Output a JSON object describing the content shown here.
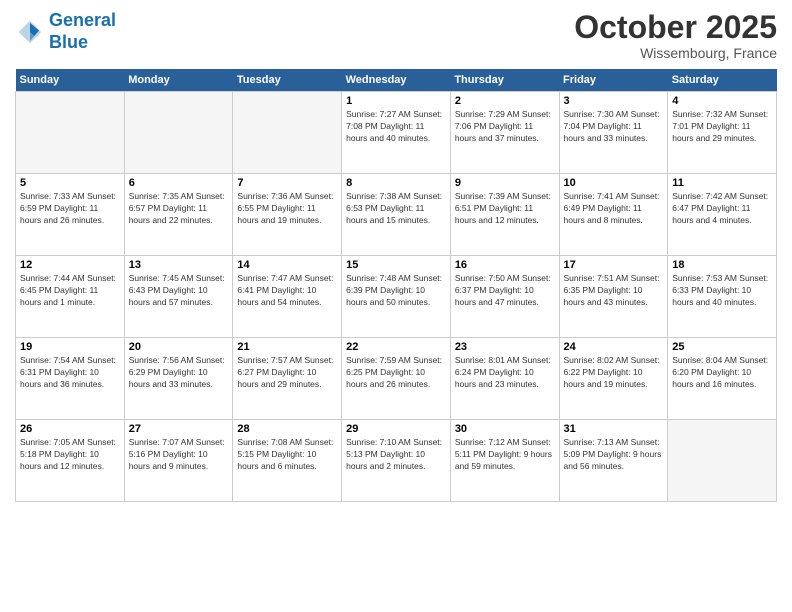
{
  "logo": {
    "line1": "General",
    "line2": "Blue"
  },
  "title": "October 2025",
  "location": "Wissembourg, France",
  "days_of_week": [
    "Sunday",
    "Monday",
    "Tuesday",
    "Wednesday",
    "Thursday",
    "Friday",
    "Saturday"
  ],
  "weeks": [
    [
      {
        "day": "",
        "info": ""
      },
      {
        "day": "",
        "info": ""
      },
      {
        "day": "",
        "info": ""
      },
      {
        "day": "1",
        "info": "Sunrise: 7:27 AM\nSunset: 7:08 PM\nDaylight: 11 hours\nand 40 minutes."
      },
      {
        "day": "2",
        "info": "Sunrise: 7:29 AM\nSunset: 7:06 PM\nDaylight: 11 hours\nand 37 minutes."
      },
      {
        "day": "3",
        "info": "Sunrise: 7:30 AM\nSunset: 7:04 PM\nDaylight: 11 hours\nand 33 minutes."
      },
      {
        "day": "4",
        "info": "Sunrise: 7:32 AM\nSunset: 7:01 PM\nDaylight: 11 hours\nand 29 minutes."
      }
    ],
    [
      {
        "day": "5",
        "info": "Sunrise: 7:33 AM\nSunset: 6:59 PM\nDaylight: 11 hours\nand 26 minutes."
      },
      {
        "day": "6",
        "info": "Sunrise: 7:35 AM\nSunset: 6:57 PM\nDaylight: 11 hours\nand 22 minutes."
      },
      {
        "day": "7",
        "info": "Sunrise: 7:36 AM\nSunset: 6:55 PM\nDaylight: 11 hours\nand 19 minutes."
      },
      {
        "day": "8",
        "info": "Sunrise: 7:38 AM\nSunset: 6:53 PM\nDaylight: 11 hours\nand 15 minutes."
      },
      {
        "day": "9",
        "info": "Sunrise: 7:39 AM\nSunset: 6:51 PM\nDaylight: 11 hours\nand 12 minutes."
      },
      {
        "day": "10",
        "info": "Sunrise: 7:41 AM\nSunset: 6:49 PM\nDaylight: 11 hours\nand 8 minutes."
      },
      {
        "day": "11",
        "info": "Sunrise: 7:42 AM\nSunset: 6:47 PM\nDaylight: 11 hours\nand 4 minutes."
      }
    ],
    [
      {
        "day": "12",
        "info": "Sunrise: 7:44 AM\nSunset: 6:45 PM\nDaylight: 11 hours\nand 1 minute."
      },
      {
        "day": "13",
        "info": "Sunrise: 7:45 AM\nSunset: 6:43 PM\nDaylight: 10 hours\nand 57 minutes."
      },
      {
        "day": "14",
        "info": "Sunrise: 7:47 AM\nSunset: 6:41 PM\nDaylight: 10 hours\nand 54 minutes."
      },
      {
        "day": "15",
        "info": "Sunrise: 7:48 AM\nSunset: 6:39 PM\nDaylight: 10 hours\nand 50 minutes."
      },
      {
        "day": "16",
        "info": "Sunrise: 7:50 AM\nSunset: 6:37 PM\nDaylight: 10 hours\nand 47 minutes."
      },
      {
        "day": "17",
        "info": "Sunrise: 7:51 AM\nSunset: 6:35 PM\nDaylight: 10 hours\nand 43 minutes."
      },
      {
        "day": "18",
        "info": "Sunrise: 7:53 AM\nSunset: 6:33 PM\nDaylight: 10 hours\nand 40 minutes."
      }
    ],
    [
      {
        "day": "19",
        "info": "Sunrise: 7:54 AM\nSunset: 6:31 PM\nDaylight: 10 hours\nand 36 minutes."
      },
      {
        "day": "20",
        "info": "Sunrise: 7:56 AM\nSunset: 6:29 PM\nDaylight: 10 hours\nand 33 minutes."
      },
      {
        "day": "21",
        "info": "Sunrise: 7:57 AM\nSunset: 6:27 PM\nDaylight: 10 hours\nand 29 minutes."
      },
      {
        "day": "22",
        "info": "Sunrise: 7:59 AM\nSunset: 6:25 PM\nDaylight: 10 hours\nand 26 minutes."
      },
      {
        "day": "23",
        "info": "Sunrise: 8:01 AM\nSunset: 6:24 PM\nDaylight: 10 hours\nand 23 minutes."
      },
      {
        "day": "24",
        "info": "Sunrise: 8:02 AM\nSunset: 6:22 PM\nDaylight: 10 hours\nand 19 minutes."
      },
      {
        "day": "25",
        "info": "Sunrise: 8:04 AM\nSunset: 6:20 PM\nDaylight: 10 hours\nand 16 minutes."
      }
    ],
    [
      {
        "day": "26",
        "info": "Sunrise: 7:05 AM\nSunset: 5:18 PM\nDaylight: 10 hours\nand 12 minutes."
      },
      {
        "day": "27",
        "info": "Sunrise: 7:07 AM\nSunset: 5:16 PM\nDaylight: 10 hours\nand 9 minutes."
      },
      {
        "day": "28",
        "info": "Sunrise: 7:08 AM\nSunset: 5:15 PM\nDaylight: 10 hours\nand 6 minutes."
      },
      {
        "day": "29",
        "info": "Sunrise: 7:10 AM\nSunset: 5:13 PM\nDaylight: 10 hours\nand 2 minutes."
      },
      {
        "day": "30",
        "info": "Sunrise: 7:12 AM\nSunset: 5:11 PM\nDaylight: 9 hours\nand 59 minutes."
      },
      {
        "day": "31",
        "info": "Sunrise: 7:13 AM\nSunset: 5:09 PM\nDaylight: 9 hours\nand 56 minutes."
      },
      {
        "day": "",
        "info": ""
      }
    ]
  ]
}
